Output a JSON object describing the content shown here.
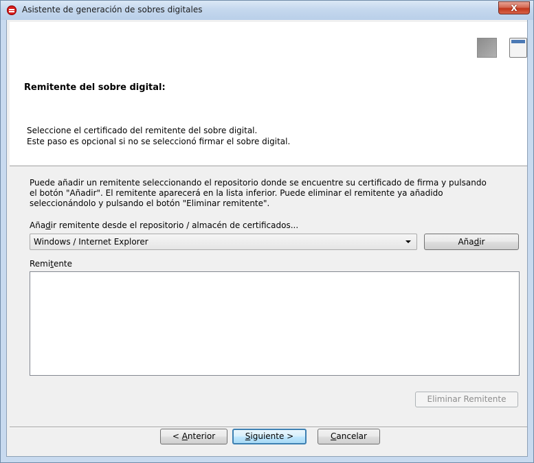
{
  "window": {
    "title": "Asistente de generación de sobres digitales",
    "close_label": "X"
  },
  "header": {
    "step_title": "Remitente del sobre digital:",
    "description_line1": "Seleccione el certificado del remitente del sobre digital.",
    "description_line2": "Este paso es opcional si no se seleccionó firmar el sobre digital."
  },
  "body": {
    "info_line1": "Puede añadir un remitente seleccionando el repositorio donde se encuentre su certificado de firma y pulsando",
    "info_line2": "el botón \"Añadir\". El remitente aparecerá en la lista inferior. Puede eliminar el remitente ya añadido",
    "info_line3": "seleccionándolo y pulsando el botón \"Eliminar remitente\".",
    "repo_label_pre": "Aña",
    "repo_label_mnemonic": "d",
    "repo_label_post": "ir remitente desde el repositorio / almacén de certificados...",
    "repo_selected": "Windows / Internet Explorer",
    "add_button_pre": "Aña",
    "add_button_mnemonic": "d",
    "add_button_post": "ir",
    "list_label_pre": "Remi",
    "list_label_mnemonic": "t",
    "list_label_post": "ente",
    "remove_button": "Eliminar Remitente"
  },
  "footer": {
    "prev_pre": "< ",
    "prev_mnemonic": "A",
    "prev_post": "nterior",
    "next_mnemonic": "S",
    "next_post": "iguiente >",
    "cancel_mnemonic": "C",
    "cancel_post": "ancelar"
  },
  "colors": {
    "titlebar": "#c5d8ee",
    "close_button": "#c1361b",
    "default_button_border": "#3c7fb1",
    "view_icon_accent": "#4b79b4"
  },
  "icons": {
    "app": "app-logo-icon",
    "view1": "view-mode-gray-icon",
    "view2": "view-mode-window-icon",
    "dropdown": "chevron-down-icon"
  }
}
